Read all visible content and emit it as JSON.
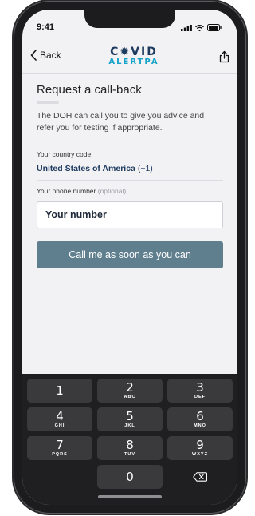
{
  "status": {
    "time": "9:41"
  },
  "nav": {
    "back_label": "Back",
    "logo_top": "C✹VID",
    "logo_bottom": "ALERTPA"
  },
  "page": {
    "title": "Request a call-back",
    "description": "The DOH can call you to give you advice and refer you for testing if appropriate.",
    "country_label": "Your country code",
    "country_value": "United States of America",
    "country_code": "(+1)",
    "phone_label": "Your phone number",
    "phone_optional": "(optional)",
    "phone_placeholder": "Your number",
    "cta_label": "Call me as soon as you can"
  },
  "keypad": {
    "rows": [
      [
        {
          "num": "1",
          "letters": ""
        },
        {
          "num": "2",
          "letters": "ABC"
        },
        {
          "num": "3",
          "letters": "DEF"
        }
      ],
      [
        {
          "num": "4",
          "letters": "GHI"
        },
        {
          "num": "5",
          "letters": "JKL"
        },
        {
          "num": "6",
          "letters": "MNO"
        }
      ],
      [
        {
          "num": "7",
          "letters": "PQRS"
        },
        {
          "num": "8",
          "letters": "TUV"
        },
        {
          "num": "9",
          "letters": "WXYZ"
        }
      ],
      [
        {
          "num": "",
          "letters": ""
        },
        {
          "num": "0",
          "letters": ""
        },
        {
          "num": "",
          "letters": ""
        }
      ]
    ]
  },
  "colors": {
    "brand_navy": "#1e3a5f",
    "brand_cyan": "#16a3c9",
    "cta_bg": "#5f7f8f"
  }
}
